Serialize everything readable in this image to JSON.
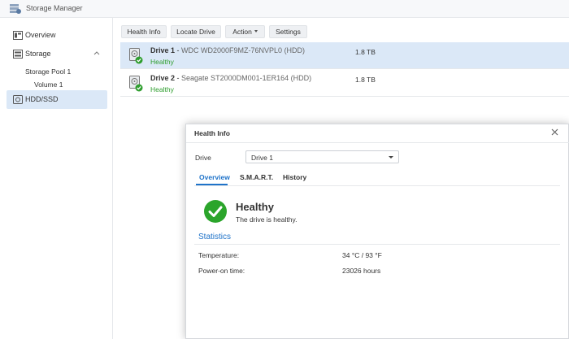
{
  "app": {
    "title": "Storage Manager"
  },
  "sidebar": {
    "items": [
      {
        "label": "Overview",
        "icon": "overview-icon"
      },
      {
        "label": "Storage",
        "icon": "storage-icon",
        "expanded": true
      },
      {
        "label": "Storage Pool 1"
      },
      {
        "label": "Volume 1"
      },
      {
        "label": "HDD/SSD",
        "icon": "hdd-icon",
        "selected": true
      }
    ]
  },
  "toolbar": {
    "health_info": "Health Info",
    "locate_drive": "Locate Drive",
    "action": "Action",
    "settings": "Settings"
  },
  "drives": [
    {
      "name": "Drive 1",
      "model": "WDC WD2000F9MZ-76NVPL0 (HDD)",
      "status": "Healthy",
      "size": "1.8 TB",
      "selected": true
    },
    {
      "name": "Drive 2",
      "model": "Seagate ST2000DM001-1ER164 (HDD)",
      "status": "Healthy",
      "size": "1.8 TB",
      "selected": false
    }
  ],
  "dialog": {
    "title": "Health Info",
    "drive_label": "Drive",
    "drive_select_value": "Drive 1",
    "tabs": [
      {
        "label": "Overview",
        "active": true
      },
      {
        "label": "S.M.A.R.T.",
        "active": false
      },
      {
        "label": "History",
        "active": false
      }
    ],
    "health_title": "Healthy",
    "health_desc": "The drive is healthy.",
    "statistics_title": "Statistics",
    "stats": [
      {
        "label": "Temperature:",
        "value": "34 °C / 93 °F"
      },
      {
        "label": "Power-on time:",
        "value": "23026 hours"
      }
    ]
  },
  "colors": {
    "accent": "#1f73c9",
    "healthy": "#2f9e2f",
    "selection": "#dbe8f7"
  }
}
